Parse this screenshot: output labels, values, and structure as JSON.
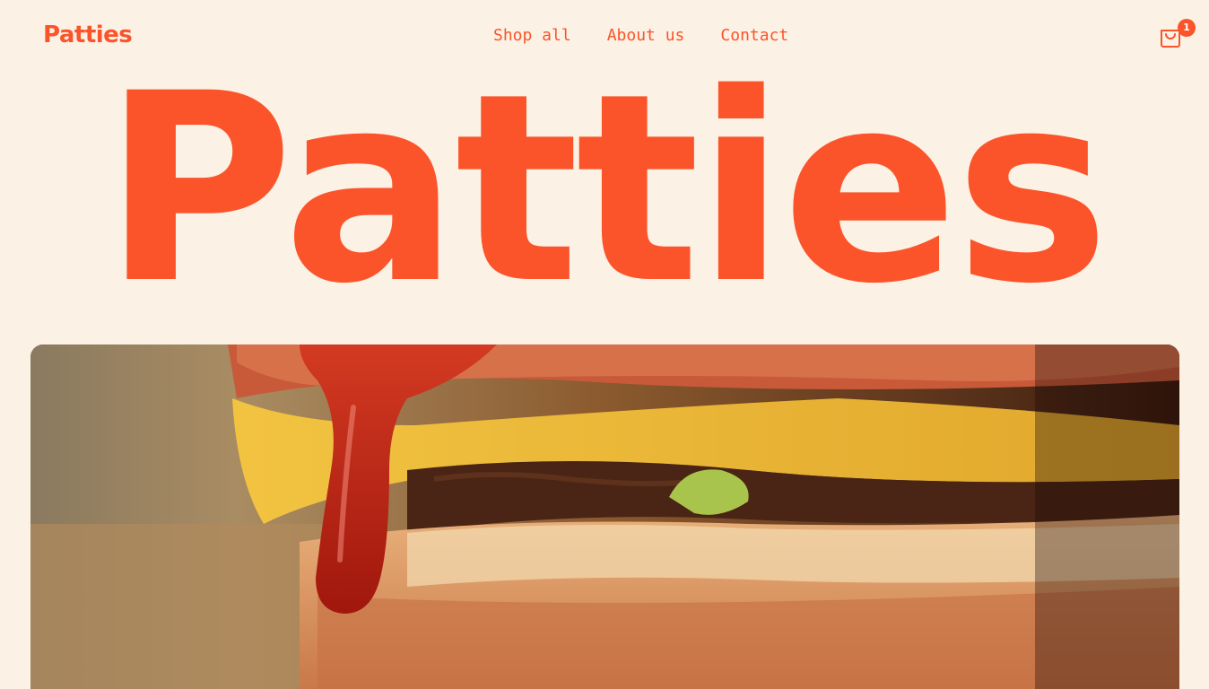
{
  "header": {
    "logo_text": "Patties",
    "nav": [
      {
        "label": "Shop all"
      },
      {
        "label": "About us"
      },
      {
        "label": "Contact"
      }
    ],
    "cart": {
      "icon": "shopping-bag-icon",
      "count": "1"
    }
  },
  "hero": {
    "title": "Patties",
    "image_subject": "close-up of a burger with ketchup, cheese and patty"
  },
  "colors": {
    "accent": "#fb542b",
    "background": "#fbf1e4"
  }
}
